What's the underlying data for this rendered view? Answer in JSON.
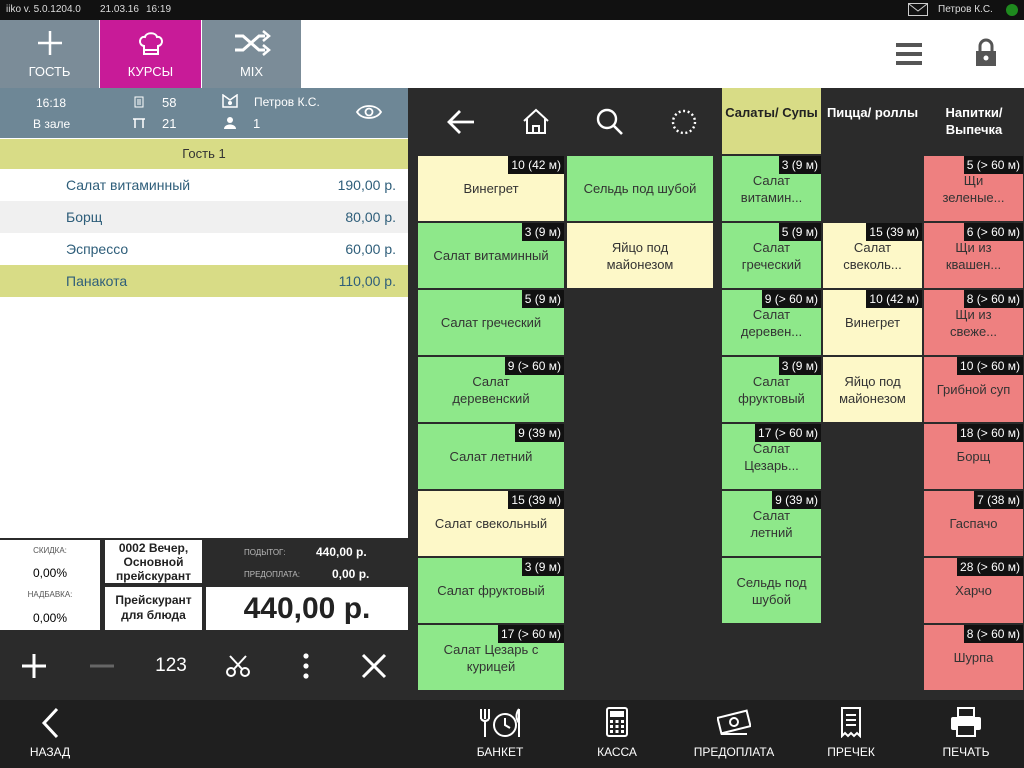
{
  "status_bar": {
    "version": "iiko  v. 5.0.1204.0",
    "date": "21.03.16",
    "time": "16:19",
    "user": "Петров К.С."
  },
  "toolbar": {
    "guest_label": "ГОСТЬ",
    "courses_label": "КУРСЫ",
    "mix_label": "MIX"
  },
  "order": {
    "time": "16:18",
    "location": "В зале",
    "order_no": "58",
    "table_no": "21",
    "waiter": "Петров К.С.",
    "guests": "1",
    "guest_group": "Гость 1",
    "items": [
      {
        "name": "Салат витаминный",
        "price": "190,00 р."
      },
      {
        "name": "Борщ",
        "price": "80,00 р."
      },
      {
        "name": "Эспрессо",
        "price": "60,00 р."
      },
      {
        "name": "Панакота",
        "price": "110,00 р."
      }
    ],
    "discount_label": "СКИДКА:",
    "discount_value": "0,00%",
    "surcharge_label": "НАДБАВКА:",
    "surcharge_value": "0,00%",
    "pricelist": "0002 Вечер, Основной прейскурант",
    "dish_pricelist": "Прейскурант для блюда",
    "subtotal_label": "ПОДЫТОГ:",
    "subtotal": "440,00 р.",
    "prepay_label": "ПРЕДОПЛАТА:",
    "prepay": "0,00 р.",
    "total": "440,00 р.",
    "qty_label": "123"
  },
  "categories": [
    {
      "label": "Салаты/ Супы",
      "active": true
    },
    {
      "label": "Пицца/ роллы",
      "active": false
    },
    {
      "label": "Напитки/ Выпечка",
      "active": false
    }
  ],
  "menu_col1": [
    {
      "name": "Винегрет",
      "time": "10 (42 м)",
      "color": "yellow"
    },
    {
      "name": "Салат витаминный",
      "time": "3 (9 м)",
      "color": "green"
    },
    {
      "name": "Салат греческий",
      "time": "5 (9 м)",
      "color": "green"
    },
    {
      "name": "Салат деревенский",
      "time": "9 (> 60 м)",
      "color": "green"
    },
    {
      "name": "Салат летний",
      "time": "9 (39 м)",
      "color": "green"
    },
    {
      "name": "Салат свекольный",
      "time": "15 (39 м)",
      "color": "yellow"
    },
    {
      "name": "Салат фруктовый",
      "time": "3 (9 м)",
      "color": "green"
    },
    {
      "name": "Салат Цезарь с курицей",
      "time": "17 (> 60 м)",
      "color": "green"
    }
  ],
  "menu_col2": [
    {
      "name": "Сельдь под шубой",
      "time": "",
      "color": "green"
    },
    {
      "name": "Яйцо под майонезом",
      "time": "",
      "color": "yellow"
    }
  ],
  "menu_col3": [
    {
      "name": "Салат витамин...",
      "time": "3 (9 м)",
      "color": "green"
    },
    {
      "name": "Салат греческий",
      "time": "5 (9 м)",
      "color": "green"
    },
    {
      "name": "Салат деревен...",
      "time": "9 (> 60 м)",
      "color": "green"
    },
    {
      "name": "Салат фруктовый",
      "time": "3 (9 м)",
      "color": "green"
    },
    {
      "name": "Салат Цезарь...",
      "time": "17 (> 60 м)",
      "color": "green"
    },
    {
      "name": "Салат летний",
      "time": "9 (39 м)",
      "color": "green"
    },
    {
      "name": "Сельдь под шубой",
      "time": "",
      "color": "green"
    }
  ],
  "menu_col4": [
    {
      "name": "Салат свеколь...",
      "time": "15 (39 м)",
      "color": "yellow"
    },
    {
      "name": "Винегрет",
      "time": "10 (42 м)",
      "color": "yellow"
    },
    {
      "name": "Яйцо под майонезом",
      "time": "",
      "color": "yellow"
    }
  ],
  "menu_col5": [
    {
      "name": "Щи зеленые...",
      "time": "5 (> 60 м)",
      "color": "red"
    },
    {
      "name": "Щи из квашен...",
      "time": "6 (> 60 м)",
      "color": "red"
    },
    {
      "name": "Щи из свеже...",
      "time": "8 (> 60 м)",
      "color": "red"
    },
    {
      "name": "Грибной суп",
      "time": "10 (> 60 м)",
      "color": "red"
    },
    {
      "name": "Борщ",
      "time": "18 (> 60 м)",
      "color": "red"
    },
    {
      "name": "Гаспачо",
      "time": "7 (38 м)",
      "color": "red"
    },
    {
      "name": "Харчо",
      "time": "28 (> 60 м)",
      "color": "red"
    },
    {
      "name": "Шурпа",
      "time": "8 (> 60 м)",
      "color": "red"
    }
  ],
  "bottom_bar": {
    "back": "НАЗАД",
    "banquet": "БАНКЕТ",
    "cashier": "КАССА",
    "prepay": "ПРЕДОПЛАТА",
    "precheck": "ПРЕЧЕК",
    "print": "ПЕЧАТЬ"
  },
  "colors": {
    "green": "#8ee88a",
    "yellow": "#fdf8c8",
    "red": "#ee8080",
    "courses_accent": "#c81b98",
    "toolbar_gray": "#7b8c98"
  }
}
